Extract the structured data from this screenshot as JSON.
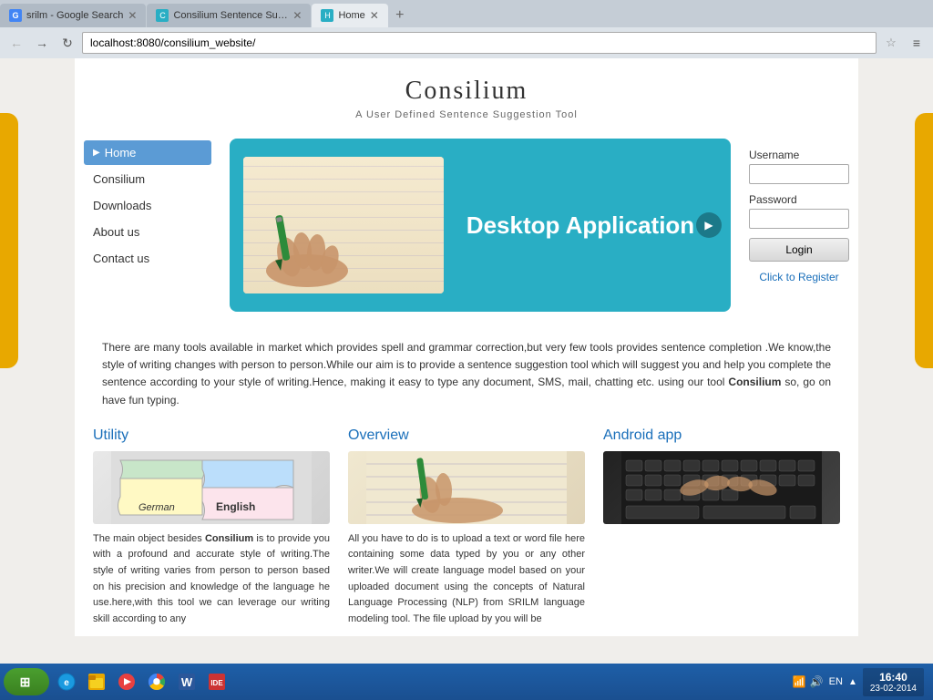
{
  "browser": {
    "tabs": [
      {
        "label": "srilm - Google Search",
        "favicon": "G",
        "active": false
      },
      {
        "label": "Consilium Sentence Sugg...",
        "favicon": "C",
        "active": false
      },
      {
        "label": "Home",
        "favicon": "H",
        "active": true
      }
    ],
    "address": "localhost:8080/consilium_website/",
    "new_tab_title": "New tab"
  },
  "site": {
    "title": "Consilium",
    "subtitle": "A User Defined Sentence Suggestion Tool",
    "hero": {
      "title": "Desktop Application",
      "nav_next": "▶"
    },
    "nav": {
      "items": [
        {
          "label": "Home",
          "active": true
        },
        {
          "label": "Consilium",
          "active": false
        },
        {
          "label": "Downloads",
          "active": false
        },
        {
          "label": "About us",
          "active": false
        },
        {
          "label": "Contact us",
          "active": false
        }
      ]
    },
    "login": {
      "username_label": "Username",
      "password_label": "Password",
      "login_btn": "Login",
      "register_link": "Click to Register"
    },
    "description": "There are many tools available in market which provides spell and grammar correction,but very few tools provides sentence completion .We know,the style of writing changes with person to person.While our aim is to provide a sentence suggestion tool which will suggest you and help you complete the sentence according to your style of writing.Hence, making it easy to type any document, SMS, mail, chatting etc. using our tool Consilium so, go on have fun typing.",
    "brand": "Consilium",
    "columns": [
      {
        "title": "Utility",
        "text": "The main object besides Consilium is to provide you with a profound and accurate style of writing.The style of writing varies from person to person based on his precision and knowledge of the language he use.here,with this tool we can leverage our writing skill according to any"
      },
      {
        "title": "Overview",
        "text": "All you have to do is to upload a text or word file here containing some data typed by you or any other writer.We will create language model based on your uploaded document using the concepts of Natural Language Processing (NLP) from SRILM language modeling tool. The file upload by you will be"
      },
      {
        "title": "Android app",
        "text": ""
      }
    ]
  },
  "taskbar": {
    "start_label": "Start",
    "lang": "EN",
    "time": "16:40",
    "date": "23-02-2014"
  }
}
